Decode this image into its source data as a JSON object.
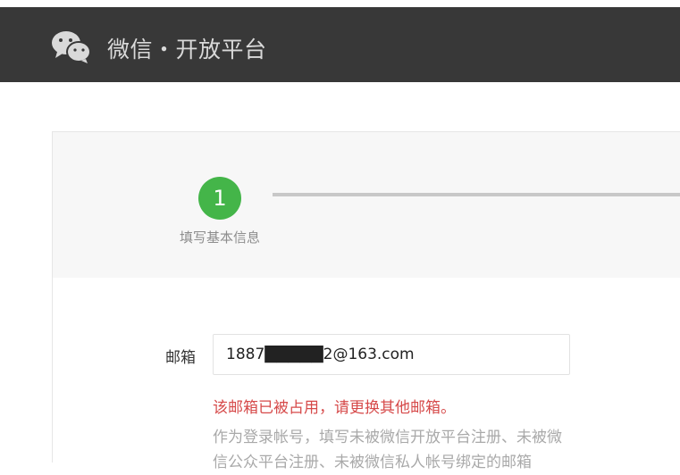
{
  "header": {
    "brand": "微信・开放平台",
    "logo_icon": "wechat-logo-icon"
  },
  "steps": {
    "current_number": "1",
    "current_label": "填写基本信息",
    "active_color": "#44b549"
  },
  "form": {
    "email_label": "邮箱",
    "email_value": "1887█████2@163.com",
    "error": "该邮箱已被占用，请更换其他邮箱。",
    "hint": "作为登录帐号，填写未被微信开放平台注册、未被微信公众平台注册、未被微信私人帐号绑定的邮箱"
  },
  "colors": {
    "header_bg": "#383838",
    "error": "#d64a4a"
  }
}
